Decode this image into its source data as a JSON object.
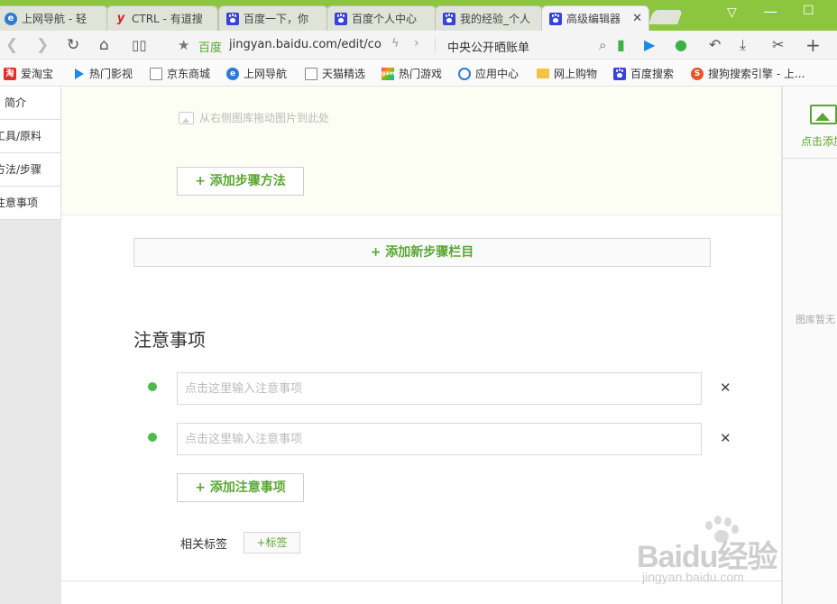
{
  "tabs": [
    {
      "title": "上网导航 - 轻",
      "icon": "ie-icon"
    },
    {
      "title": "CTRL - 有道搜",
      "icon": "youdao-icon"
    },
    {
      "title": "百度一下，你",
      "icon": "baidu-paw-icon"
    },
    {
      "title": "百度个人中心",
      "icon": "baidu-paw-icon"
    },
    {
      "title": "我的经验_个人",
      "icon": "baidu-paw-icon"
    },
    {
      "title": "高级编辑器",
      "icon": "baidu-paw-icon",
      "active": true
    }
  ],
  "address": {
    "site": "百度",
    "url": "jingyan.baidu.com/edit/cor",
    "search": "中央公开晒账单"
  },
  "bookmarks": [
    "爱淘宝",
    "热门影视",
    "京东商城",
    "上网导航",
    "天猫精选",
    "热门游戏",
    "应用中心",
    "网上购物",
    "百度搜索",
    "搜狗搜索引擎 - 上..."
  ],
  "bookmark_icon_text": {
    "tao": "淘",
    "game": "game"
  },
  "sidebar": {
    "items": [
      "简介",
      "工具/原料",
      "方法/步骤",
      "注意事项"
    ]
  },
  "editor": {
    "drop_hint": "从右侧图库拖动图片到此处",
    "add_step_method": "+ 添加步骤方法",
    "add_section": "+ 添加新步骤栏目",
    "notes_title": "注意事项",
    "note_placeholder": "点击这里输入注意事项",
    "add_note": "+ 添加注意事项",
    "tags_label": "相关标签",
    "add_tag": "+标签"
  },
  "gallery": {
    "add_label": "点击添加",
    "empty_text": "图库暂无"
  },
  "watermark": {
    "brand": "Baidu经验",
    "url": "jingyan.baidu.com"
  },
  "colors": {
    "browser_green": "#8cc63f",
    "accent_green": "#5aa632",
    "dot_green": "#4cbb4a"
  }
}
